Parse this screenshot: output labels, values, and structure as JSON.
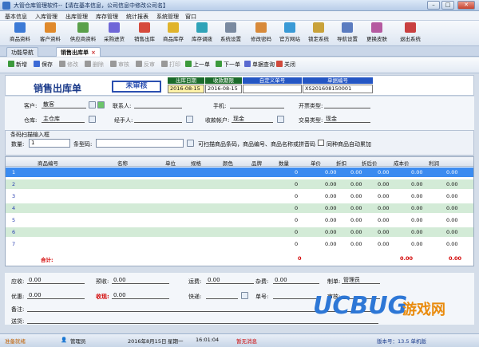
{
  "window": {
    "title": "大管仓库管理软件--【请在基本信息，公司信息中修改公司名】"
  },
  "menu": [
    "基本信息",
    "入库管理",
    "出库管理",
    "库存管理",
    "统计报表",
    "系统管理",
    "窗口"
  ],
  "toolbar": [
    {
      "label": "商品资料",
      "color": "#3c7ad6"
    },
    {
      "label": "客户资料",
      "color": "#e08a2c"
    },
    {
      "label": "供应商资料",
      "color": "#5aa04a"
    },
    {
      "label": "采购进货",
      "color": "#6f66d8"
    },
    {
      "label": "销售出库",
      "color": "#d64a3c"
    },
    {
      "label": "商品库存",
      "color": "#e0b42c"
    },
    {
      "label": "库存调拨",
      "color": "#2fa3b8"
    },
    {
      "label": "系统设置",
      "color": "#7a8aa0"
    },
    {
      "label": "修改密码",
      "color": "#d88a3a"
    },
    {
      "label": "官方网站",
      "color": "#3a9ad6"
    },
    {
      "label": "锁定系统",
      "color": "#c9a23a"
    },
    {
      "label": "导航设置",
      "color": "#5b7cc0"
    },
    {
      "label": "更换皮肤",
      "color": "#b55aa0"
    },
    {
      "label": "退出系统",
      "color": "#c94040"
    }
  ],
  "tabs": [
    {
      "label": "功能导航"
    },
    {
      "label": "销售出库单",
      "close": "×"
    }
  ],
  "actions": [
    {
      "label": "新增",
      "color": "#3c9a3c",
      "disabled": false
    },
    {
      "label": "保存",
      "color": "#3c6ad6",
      "disabled": false
    },
    {
      "label": "修改",
      "color": "#999",
      "disabled": true
    },
    {
      "label": "删除",
      "color": "#999",
      "disabled": true
    },
    {
      "label": "审核",
      "color": "#999",
      "disabled": true
    },
    {
      "label": "反审",
      "color": "#999",
      "disabled": true
    },
    {
      "label": "打印",
      "color": "#999",
      "disabled": true
    },
    {
      "label": "上一单",
      "color": "#3c9a3c",
      "disabled": false
    },
    {
      "label": "下一单",
      "color": "#3c9a3c",
      "disabled": false
    },
    {
      "label": "单据查询",
      "color": "#5a6ad0",
      "disabled": false
    },
    {
      "label": "关闭",
      "color": "#d04a3c",
      "disabled": false
    }
  ],
  "header": {
    "doc_title": "销售出库单",
    "stamp": "未审核",
    "cols": [
      "出库日期",
      "收款期限",
      "自定义单号",
      "单据编号"
    ],
    "vals": [
      "2016-08-15",
      "2016-08-15",
      "",
      "XS201608150001"
    ]
  },
  "form": {
    "customer_label": "客户:",
    "customer": "散客",
    "contact_label": "联系人:",
    "contact": "",
    "phone_label": "手机:",
    "phone": "",
    "invoice_label": "开票类型:",
    "invoice": "",
    "warehouse_label": "仓库:",
    "warehouse": "主仓库",
    "handler_label": "经手人:",
    "handler": "",
    "account_label": "收款帐户:",
    "account": "现金",
    "trade_label": "交易类型:",
    "trade": "现金"
  },
  "scan": {
    "title": "条码扫描输入框",
    "qty_label": "数量:",
    "qty": "1",
    "code_label": "条型码:",
    "code": "",
    "hint": "可扫描商品条码，商品编号、商品名称或拼音码",
    "auto_label": "同种商品自动累加"
  },
  "grid": {
    "headers": [
      "商品编号",
      "名称",
      "单位",
      "规格",
      "颜色",
      "品牌",
      "数量",
      "单价",
      "折扣",
      "折后价",
      "成本价",
      "利润"
    ],
    "rows": [
      {
        "n": "1",
        "qty": "0",
        "price": "0.00",
        "disc": "0.00",
        "dprice": "0.00",
        "cost": "0.00",
        "profit": "0.00"
      },
      {
        "n": "2",
        "qty": "0",
        "price": "0.00",
        "disc": "0.00",
        "dprice": "0.00",
        "cost": "0.00",
        "profit": "0.00"
      },
      {
        "n": "3",
        "qty": "0",
        "price": "0.00",
        "disc": "0.00",
        "dprice": "0.00",
        "cost": "0.00",
        "profit": "0.00"
      },
      {
        "n": "4",
        "qty": "0",
        "price": "0.00",
        "disc": "0.00",
        "dprice": "0.00",
        "cost": "0.00",
        "profit": "0.00"
      },
      {
        "n": "5",
        "qty": "0",
        "price": "0.00",
        "disc": "0.00",
        "dprice": "0.00",
        "cost": "0.00",
        "profit": "0.00"
      },
      {
        "n": "6",
        "qty": "0",
        "price": "0.00",
        "disc": "0.00",
        "dprice": "0.00",
        "cost": "0.00",
        "profit": "0.00"
      },
      {
        "n": "7",
        "qty": "0",
        "price": "0.00",
        "disc": "0.00",
        "dprice": "0.00",
        "cost": "0.00",
        "profit": "0.00"
      }
    ],
    "total_label": "合计:",
    "total_qty": "0",
    "total_amt": "0.00",
    "total_profit": "0.00"
  },
  "bottom": {
    "due_label": "应收:",
    "due": "0.00",
    "prepaid_label": "预收:",
    "prepaid": "0.00",
    "freight_label": "运费:",
    "freight": "0.00",
    "misc_label": "杂费:",
    "misc": "0.00",
    "maker_label": "制单:",
    "maker": "管理员",
    "discount_label": "优惠:",
    "discount": "0.00",
    "received_label": "收现:",
    "received": "0.00",
    "express_label": "快递:",
    "express": "",
    "waybill_label": "单号:",
    "waybill": "",
    "auditor_label": "审核:",
    "auditor": "",
    "remark_label": "备注:",
    "remark": "",
    "ship_label": "送货:",
    "ship": ""
  },
  "status": {
    "ready": "准备就绪",
    "user": "管理员",
    "date": "2016年8月15日",
    "weekday": "星期一",
    "time": "16:01:04",
    "msg": "暂无消息",
    "version": "版本号：13.5 单机版"
  },
  "watermark": {
    "brand": "UCBUG",
    "suffix": "游戏网"
  }
}
